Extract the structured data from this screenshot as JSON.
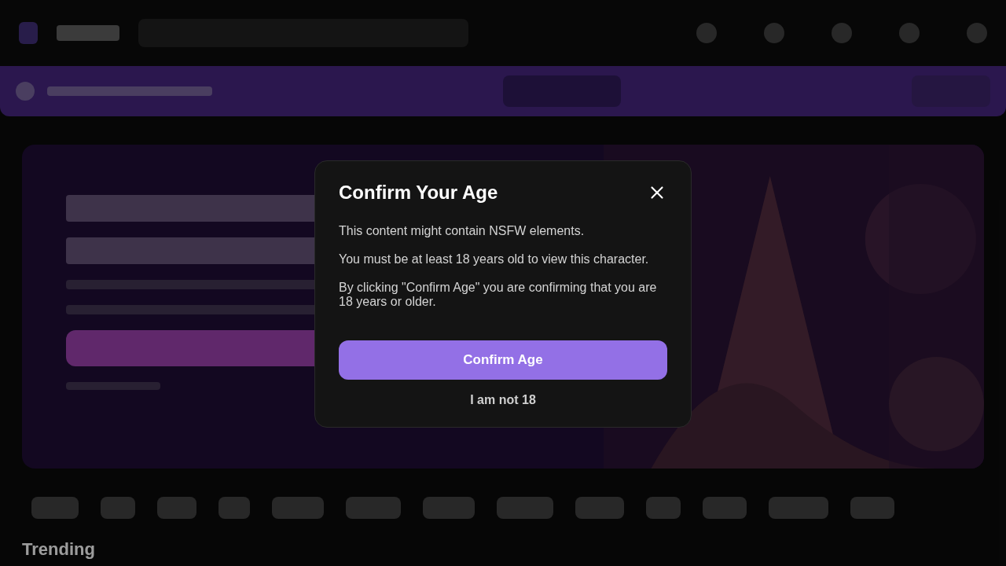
{
  "page": {
    "section_heading": "Trending"
  },
  "dialog": {
    "title": "Confirm Your Age",
    "paragraphs": [
      "This content might contain NSFW elements.",
      "You must be at least 18 years old to view this character.",
      "By clicking \"Confirm Age\" you are confirming that you are 18 years or older."
    ],
    "confirm_button": "Confirm Age",
    "decline_button": "I am not 18"
  }
}
